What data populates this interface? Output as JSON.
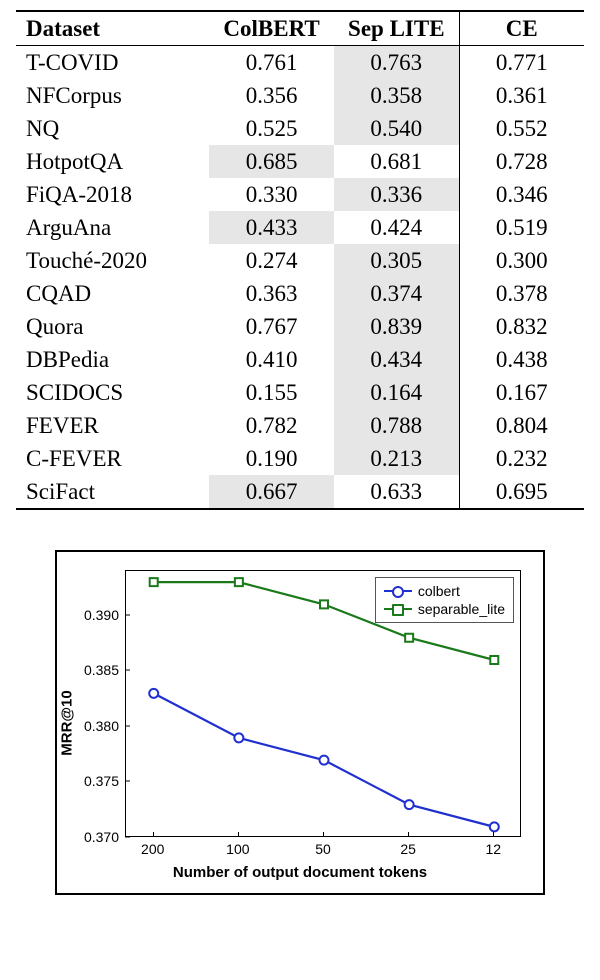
{
  "table": {
    "headers": [
      "Dataset",
      "ColBERT",
      "Sep LITE",
      "CE"
    ],
    "rows": [
      {
        "dataset": "T-COVID",
        "colbert": "0.761",
        "seplite": "0.763",
        "ce": "0.771",
        "hl": 1
      },
      {
        "dataset": "NFCorpus",
        "colbert": "0.356",
        "seplite": "0.358",
        "ce": "0.361",
        "hl": 1
      },
      {
        "dataset": "NQ",
        "colbert": "0.525",
        "seplite": "0.540",
        "ce": "0.552",
        "hl": 1
      },
      {
        "dataset": "HotpotQA",
        "colbert": "0.685",
        "seplite": "0.681",
        "ce": "0.728",
        "hl": 0
      },
      {
        "dataset": "FiQA-2018",
        "colbert": "0.330",
        "seplite": "0.336",
        "ce": "0.346",
        "hl": 1
      },
      {
        "dataset": "ArguAna",
        "colbert": "0.433",
        "seplite": "0.424",
        "ce": "0.519",
        "hl": 0
      },
      {
        "dataset": "Touché-2020",
        "colbert": "0.274",
        "seplite": "0.305",
        "ce": "0.300",
        "hl": 1
      },
      {
        "dataset": "CQAD",
        "colbert": "0.363",
        "seplite": "0.374",
        "ce": "0.378",
        "hl": 1
      },
      {
        "dataset": "Quora",
        "colbert": "0.767",
        "seplite": "0.839",
        "ce": "0.832",
        "hl": 1
      },
      {
        "dataset": "DBPedia",
        "colbert": "0.410",
        "seplite": "0.434",
        "ce": "0.438",
        "hl": 1
      },
      {
        "dataset": "SCIDOCS",
        "colbert": "0.155",
        "seplite": "0.164",
        "ce": "0.167",
        "hl": 1
      },
      {
        "dataset": "FEVER",
        "colbert": "0.782",
        "seplite": "0.788",
        "ce": "0.804",
        "hl": 1
      },
      {
        "dataset": "C-FEVER",
        "colbert": "0.190",
        "seplite": "0.213",
        "ce": "0.232",
        "hl": 1
      },
      {
        "dataset": "SciFact",
        "colbert": "0.667",
        "seplite": "0.633",
        "ce": "0.695",
        "hl": 0
      }
    ]
  },
  "chart_data": {
    "type": "line",
    "xlabel": "Number of output document tokens",
    "ylabel": "MRR@10",
    "x_categories": [
      "200",
      "100",
      "50",
      "25",
      "12"
    ],
    "ylim": [
      0.37,
      0.394
    ],
    "yticks": [
      0.37,
      0.375,
      0.38,
      0.385,
      0.39
    ],
    "series": [
      {
        "name": "colbert",
        "color": "#2030d0",
        "marker": "circle",
        "values": [
          0.383,
          0.379,
          0.377,
          0.373,
          0.371
        ]
      },
      {
        "name": "separable_lite",
        "color": "#1a7a1a",
        "marker": "square",
        "values": [
          0.393,
          0.393,
          0.391,
          0.388,
          0.386
        ]
      }
    ]
  },
  "legend": {
    "s0": "colbert",
    "s1": "separable_lite"
  }
}
